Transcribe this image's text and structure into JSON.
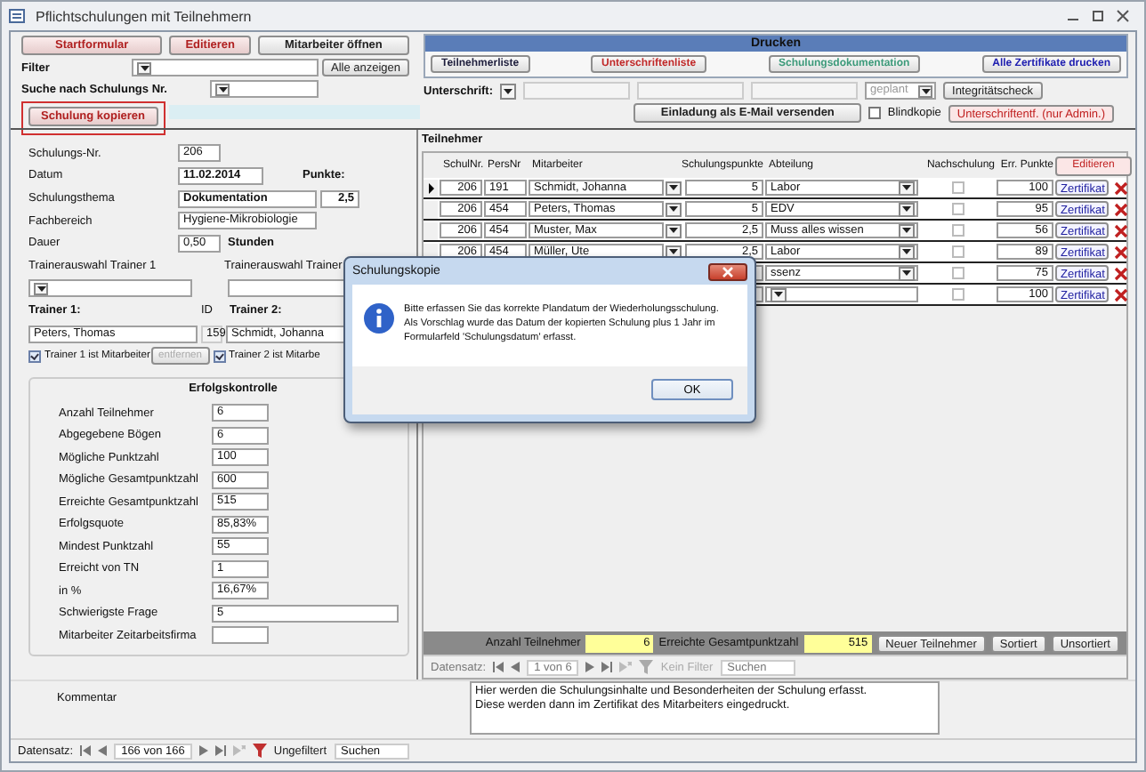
{
  "window": {
    "title": "Pflichtschulungen mit Teilnehmern"
  },
  "toolbar": {
    "buttons": [
      {
        "label": "Startformular",
        "kind": "nav"
      },
      {
        "label": "Editieren",
        "kind": "edit"
      },
      {
        "label": "Mitarbeiter öffnen",
        "kind": "plain"
      }
    ],
    "filter_label": "Filter",
    "show_all_button": "Alle anzeigen",
    "search_label": "Suche nach Schulungs Nr.",
    "copy_button": {
      "label": "Schulung kopieren",
      "highlighted": true
    }
  },
  "print_panel": {
    "title": "Drucken",
    "buttons": [
      {
        "label": "Teilnehmerliste",
        "color": "#1e1e3c"
      },
      {
        "label": "Unterschriftenliste",
        "color": "#c02828"
      },
      {
        "label": "Schulungsdokumentation",
        "color": "#3c9a7a"
      },
      {
        "label": "Alle Zertifikate drucken",
        "color": "#2020b0"
      }
    ],
    "signature_label": "Unterschrift:",
    "status": {
      "value": "geplant",
      "disabled": true
    },
    "integrity_button": "Integritätscheck",
    "email_button": "Einladung als E-Mail versenden",
    "blind_copy": {
      "label": "Blindkopie",
      "checked": false
    },
    "admin_button": "Unterschriftentf. (nur Admin.)"
  },
  "training": {
    "number": {
      "label": "Schulungs-Nr.",
      "value": "206"
    },
    "date": {
      "label": "Datum",
      "value": "11.02.2014"
    },
    "points": {
      "label": "Punkte:",
      "value": "2,5"
    },
    "topic": {
      "label": "Schulungsthema",
      "value": "Dokumentation"
    },
    "area": {
      "label": "Fachbereich",
      "value": "Hygiene-Mikrobiologie"
    },
    "duration": {
      "label": "Dauer",
      "value": "0,50",
      "unit": "Stunden"
    },
    "trainer_select_1": "Trainerauswahl Trainer 1",
    "trainer_select_2": "Trainerauswahl Trainer",
    "trainer_1": {
      "label": "Trainer 1:",
      "value": "Peters, Thomas"
    },
    "id": {
      "label": "ID",
      "value": "159"
    },
    "trainer_2": {
      "label": "Trainer 2:",
      "value": "Schmidt, Johanna"
    },
    "trainer_1_employee": {
      "label": "Trainer 1 ist Mitarbeiter",
      "checked": true
    },
    "remove_button": {
      "label": "entfernen",
      "disabled": true
    },
    "trainer_2_employee": {
      "label": "Trainer 2 ist Mitarbe",
      "checked": true
    }
  },
  "success": {
    "title": "Erfolgskontrolle",
    "fields": [
      {
        "label": "Anzahl Teilnehmer",
        "value": "6",
        "kind": "short"
      },
      {
        "label": "Abgegebene Bögen",
        "value": "6",
        "kind": "short"
      },
      {
        "label": "Mögliche Punktzahl",
        "value": "100",
        "kind": "short"
      },
      {
        "label": "Mögliche Gesamtpunktzahl",
        "value": "600",
        "kind": "short"
      },
      {
        "label": "Erreichte Gesamtpunktzahl",
        "value": "515",
        "kind": "short"
      },
      {
        "label": "Erfolgsquote",
        "value": "85,83%",
        "kind": "short"
      },
      {
        "label": "Mindest Punktzahl",
        "value": "55",
        "kind": "short"
      },
      {
        "label": "Erreicht von TN",
        "value": "1",
        "kind": "short"
      },
      {
        "label": "in %",
        "value": "16,67%",
        "kind": "short"
      },
      {
        "label": "Schwierigste Frage",
        "value": "5",
        "kind": "wide"
      },
      {
        "label": "Mitarbeiter Zeitarbeitsfirma",
        "kind": "short"
      }
    ]
  },
  "participants": {
    "title": "Teilnehmer",
    "columns": [
      "SchulNr.",
      "PersNr",
      "Mitarbeiter",
      "Schulungspunkte",
      "Abteilung",
      "Nachschulung",
      "Err. Punkte"
    ],
    "edit_button": "Editieren",
    "rows": [
      {
        "current": true,
        "schul_nr": "206",
        "pers_nr": "191",
        "name": "Schmidt, Johanna",
        "points": "5",
        "department": "Labor",
        "retraining": false,
        "score": "100",
        "certificate": "Zertifikat"
      },
      {
        "current": false,
        "schul_nr": "206",
        "pers_nr": "454",
        "name": "Peters, Thomas",
        "points": "5",
        "department": "EDV",
        "retraining": false,
        "score": "95",
        "certificate": "Zertifikat"
      },
      {
        "current": false,
        "schul_nr": "206",
        "pers_nr": "454",
        "name": "Muster, Max",
        "points": "2,5",
        "department": "Muss alles wissen",
        "retraining": false,
        "score": "56",
        "certificate": "Zertifikat"
      },
      {
        "current": false,
        "schul_nr": "206",
        "pers_nr": "454",
        "name": "Müller, Ute",
        "points": "2,5",
        "department": "Labor",
        "retraining": false,
        "score": "89",
        "certificate": "Zertifikat"
      },
      {
        "department": "ssenz",
        "retraining": false,
        "score": "75",
        "certificate": "Zertifikat"
      },
      {
        "retraining": false,
        "score": "100",
        "certificate": "Zertifikat"
      }
    ],
    "totals": {
      "count_label": "Anzahl Teilnehmer",
      "count": "6",
      "sum_label": "Erreichte Gesamtpunktzahl",
      "sum": "515"
    },
    "buttons": [
      "Neuer Teilnehmer",
      "Sortiert",
      "Unsortiert"
    ],
    "nav": {
      "label": "Datensatz:",
      "position": "1 von 6",
      "filter": "Kein Filter",
      "filtered": false,
      "search": "Suchen"
    }
  },
  "comment": {
    "label": "Kommentar",
    "lines": [
      "Hier werden die Schulungsinhalte und Besonderheiten der Schulung erfasst.",
      "Diese werden dann im Zertifikat des Mitarbeiters eingedruckt."
    ]
  },
  "nav": {
    "label": "Datensatz:",
    "position": "166 von 166",
    "filter": "Ungefiltert",
    "filtered": true,
    "search": "Suchen"
  },
  "dialog": {
    "title": "Schulungskopie",
    "lines": [
      "Bitte erfassen Sie das korrekte Plandatum der Wiederholungsschulung.",
      "Als Vorschlag wurde das Datum der kopierten Schulung plus 1 Jahr im",
      "Formularfeld 'Schulungsdatum' erfasst."
    ],
    "ok": "OK"
  }
}
